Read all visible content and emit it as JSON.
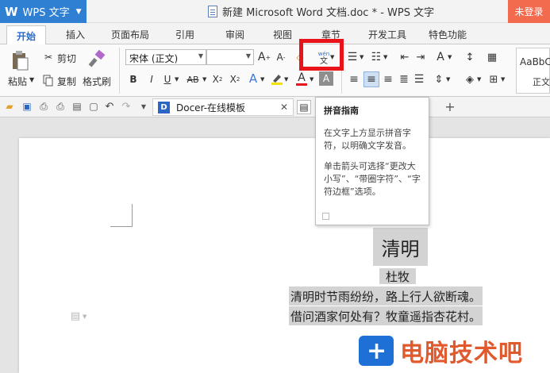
{
  "app": {
    "brand": "WPS 文字",
    "doc_title": "新建 Microsoft Word 文档.doc * - WPS 文字",
    "login": "未登录"
  },
  "tabs": [
    "开始",
    "插入",
    "页面布局",
    "引用",
    "审阅",
    "视图",
    "章节",
    "开发工具",
    "特色功能"
  ],
  "ribbon": {
    "cut": "剪切",
    "paste": "粘贴",
    "copy": "复制",
    "format_painter": "格式刷",
    "font_name": "宋体 (正文)",
    "font_size": "",
    "pinyin_top": "wén",
    "pinyin_bottom": "文",
    "style_preview": "AaBbC",
    "style_name": "正文"
  },
  "quickbar": {
    "docer_tab": "Docer-在线模板"
  },
  "tooltip": {
    "title": "拼音指南",
    "para1": "在文字上方显示拼音字符，以明确文字发音。",
    "para2": "单击箭头可选择“更改大小写”、“带圈字符”、“字符边框”选项。"
  },
  "document": {
    "heading": "清明",
    "author": "杜牧",
    "line1": "清明时节雨纷纷，路上行人欲断魂。",
    "line2": "借问酒家何处有？牧童遥指杏花村。"
  },
  "watermark": {
    "text": "电脑技术吧"
  },
  "colors": {
    "brand_blue": "#2f7fd3",
    "login_orange": "#f26b4f",
    "highlight_red": "#e8141a",
    "selection_gray": "#d3d3d3"
  }
}
